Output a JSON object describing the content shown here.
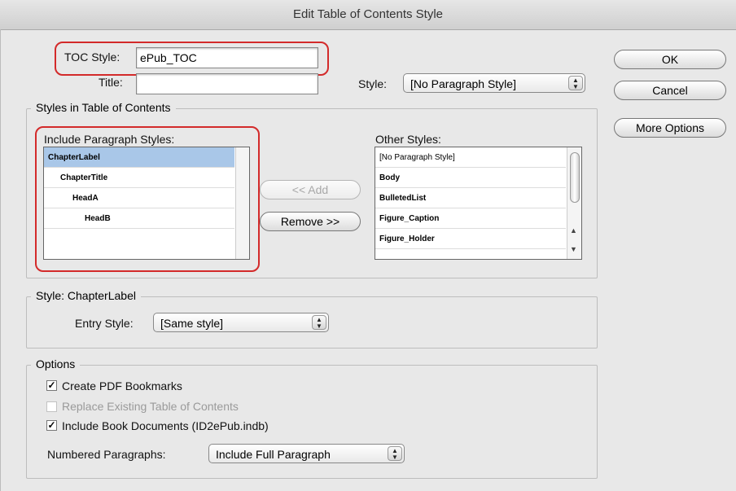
{
  "window": {
    "title": "Edit Table of Contents Style"
  },
  "toc": {
    "style_label": "TOC Style:",
    "style_value": "ePub_TOC",
    "title_label": "Title:",
    "title_value": "",
    "para_style_label": "Style:",
    "para_style_value": "[No Paragraph Style]"
  },
  "buttons": {
    "ok": "OK",
    "cancel": "Cancel",
    "more_options": "More Options",
    "add": "<< Add",
    "remove": "Remove >>"
  },
  "styles_group": {
    "label": "Styles in Table of Contents",
    "include_label": "Include Paragraph Styles:",
    "include_items": [
      "ChapterLabel",
      "ChapterTitle",
      "HeadA",
      "HeadB"
    ],
    "other_label": "Other Styles:",
    "other_items": [
      "[No Paragraph Style]",
      "Body",
      "BulletedList",
      "Figure_Caption",
      "Figure_Holder"
    ]
  },
  "style_group": {
    "label": "Style: ChapterLabel",
    "entry_style_label": "Entry Style:",
    "entry_style_value": "[Same style]"
  },
  "options_group": {
    "label": "Options",
    "create_pdf_bookmarks": "Create PDF Bookmarks",
    "replace_existing": "Replace Existing Table of Contents",
    "include_book_docs": "Include Book Documents (ID2ePub.indb)",
    "numbered_label": "Numbered Paragraphs:",
    "numbered_value": "Include Full Paragraph"
  },
  "colors": {
    "highlight": "#d32a2a",
    "selection": "#a9c7e8"
  }
}
